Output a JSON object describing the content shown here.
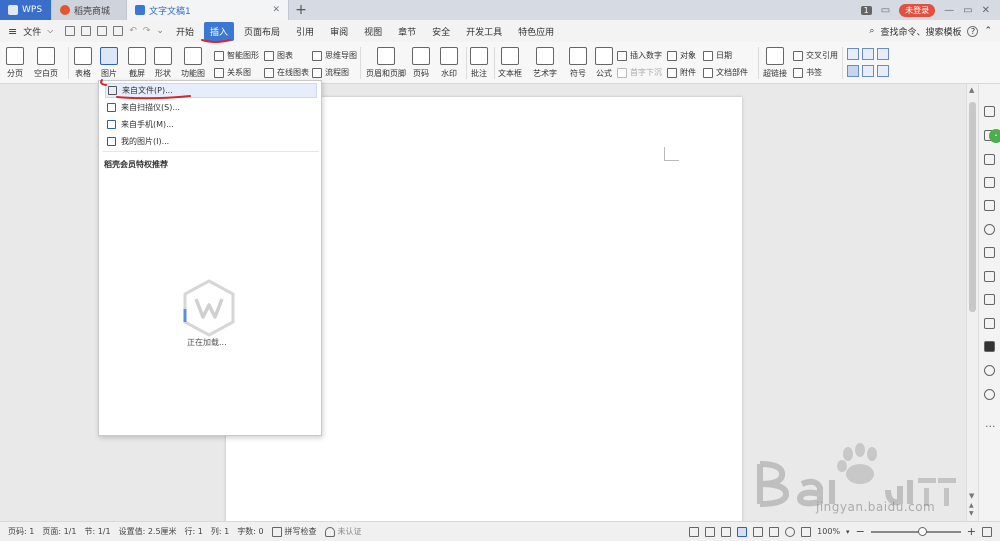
{
  "tabs": {
    "wps": "WPS",
    "shop": "稻壳商城",
    "doc": "文字文稿1",
    "badge": "1",
    "login": "未登录"
  },
  "menu": {
    "file": "文件",
    "items": [
      "开始",
      "插入",
      "页面布局",
      "引用",
      "审阅",
      "视图",
      "章节",
      "安全",
      "开发工具",
      "特色应用"
    ],
    "search": "查找命令、搜索模板"
  },
  "ribbon": {
    "page_break": "分页",
    "blank_page": "空白页",
    "table": "表格",
    "picture": "图片",
    "screenshot": "截屏",
    "shape": "形状",
    "feature_chart": "功能图",
    "smart_graphic": "智能图形",
    "chart": "图表",
    "mind_map": "思维导图",
    "relation": "关系图",
    "online_chart": "在线图表",
    "flowchart": "流程图",
    "header_footer": "页眉和页脚",
    "page_number": "页码",
    "watermark": "水印",
    "comment": "批注",
    "textbox": "文本框",
    "wordart": "艺术字",
    "symbol": "符号",
    "formula": "公式",
    "insert_number": "插入数字",
    "first_drop": "首字下沉",
    "object": "对象",
    "attachment": "附件",
    "date": "日期",
    "doc_parts": "文档部件",
    "cross_ref": "交叉引用",
    "hyperlink": "超链接",
    "bookmark": "书签"
  },
  "dropdown": {
    "items": [
      "来自文件(P)...",
      "来自扫描仪(S)...",
      "来自手机(M)...",
      "我的图片(I)..."
    ],
    "section": "稻壳会员特权推荐",
    "loading": "正在加载..."
  },
  "status": {
    "page_num": "页码: 1",
    "pages": "页面: 1/1",
    "section": "节: 1/1",
    "setting": "设置值: 2.5厘米",
    "row": "行: 1",
    "col": "列: 1",
    "words": "字数: 0",
    "spell": "拼写检查",
    "auth": "未认证",
    "zoom": "100%",
    "zoom_fraction": 0.58
  },
  "watermark": {
    "url": "jingyan.baidu.com"
  },
  "colors": {
    "accent": "#3a78d6",
    "tab_wps": "#3a6fc9",
    "annotation": "#d9262b",
    "login": "#e0513f"
  }
}
